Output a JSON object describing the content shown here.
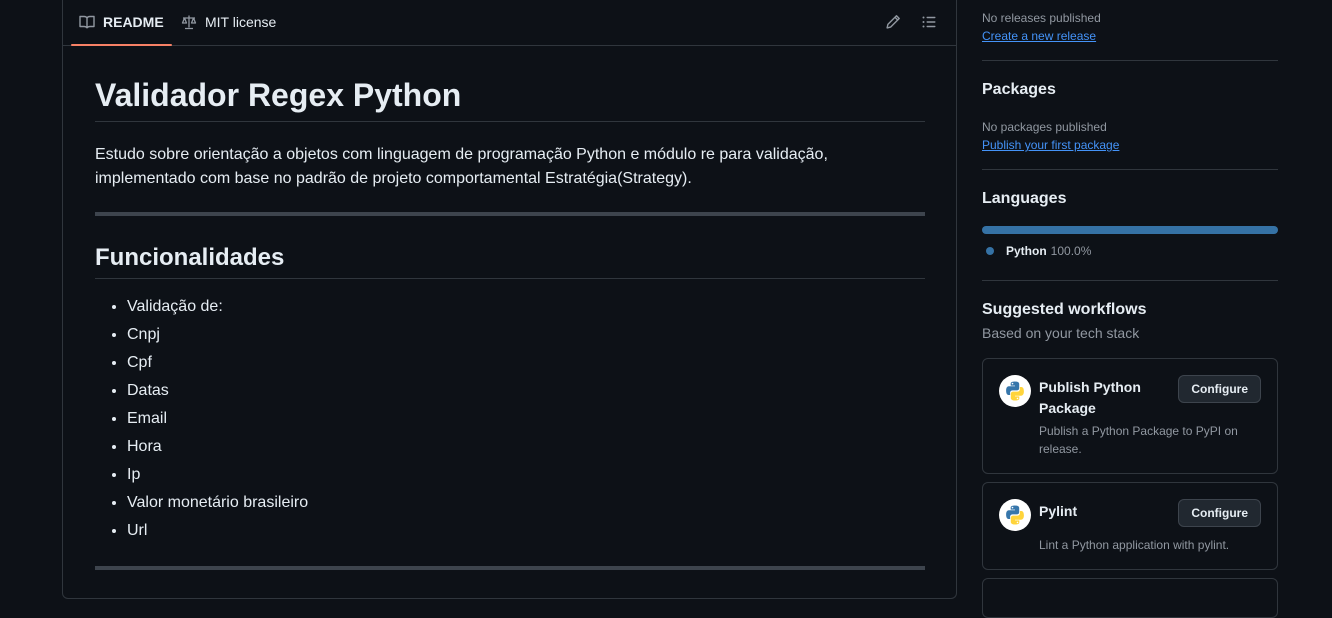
{
  "readme": {
    "tabs": [
      {
        "label": "README",
        "icon": "book-icon",
        "active": true
      },
      {
        "label": "MIT license",
        "icon": "law-icon",
        "active": false
      }
    ],
    "title": "Validador Regex Python",
    "description": "Estudo sobre orientação a objetos com linguagem de programação Python e módulo re para validação, implementado com base no padrão de projeto comportamental Estratégia(Strategy).",
    "section_heading": "Funcionalidades",
    "features": [
      "Validação de:",
      "Cnpj",
      "Cpf",
      "Datas",
      "Email",
      "Hora",
      "Ip",
      "Valor monetário brasileiro",
      "Url"
    ]
  },
  "sidebar": {
    "releases": {
      "empty_text": "No releases published",
      "link": "Create a new release"
    },
    "packages": {
      "heading": "Packages",
      "empty_text": "No packages published",
      "link": "Publish your first package"
    },
    "languages": {
      "heading": "Languages",
      "items": [
        {
          "name": "Python",
          "percent": "100.0%",
          "color": "#3572a5"
        }
      ]
    },
    "workflows": {
      "heading": "Suggested workflows",
      "subheading": "Based on your tech stack",
      "items": [
        {
          "title": "Publish Python Package",
          "description": "Publish a Python Package to PyPI on release.",
          "button": "Configure"
        },
        {
          "title": "Pylint",
          "description": "Lint a Python application with pylint.",
          "button": "Configure"
        }
      ]
    }
  },
  "colors": {
    "accent_tab": "#f78166",
    "link": "#4493f8",
    "background": "#0d1117"
  }
}
